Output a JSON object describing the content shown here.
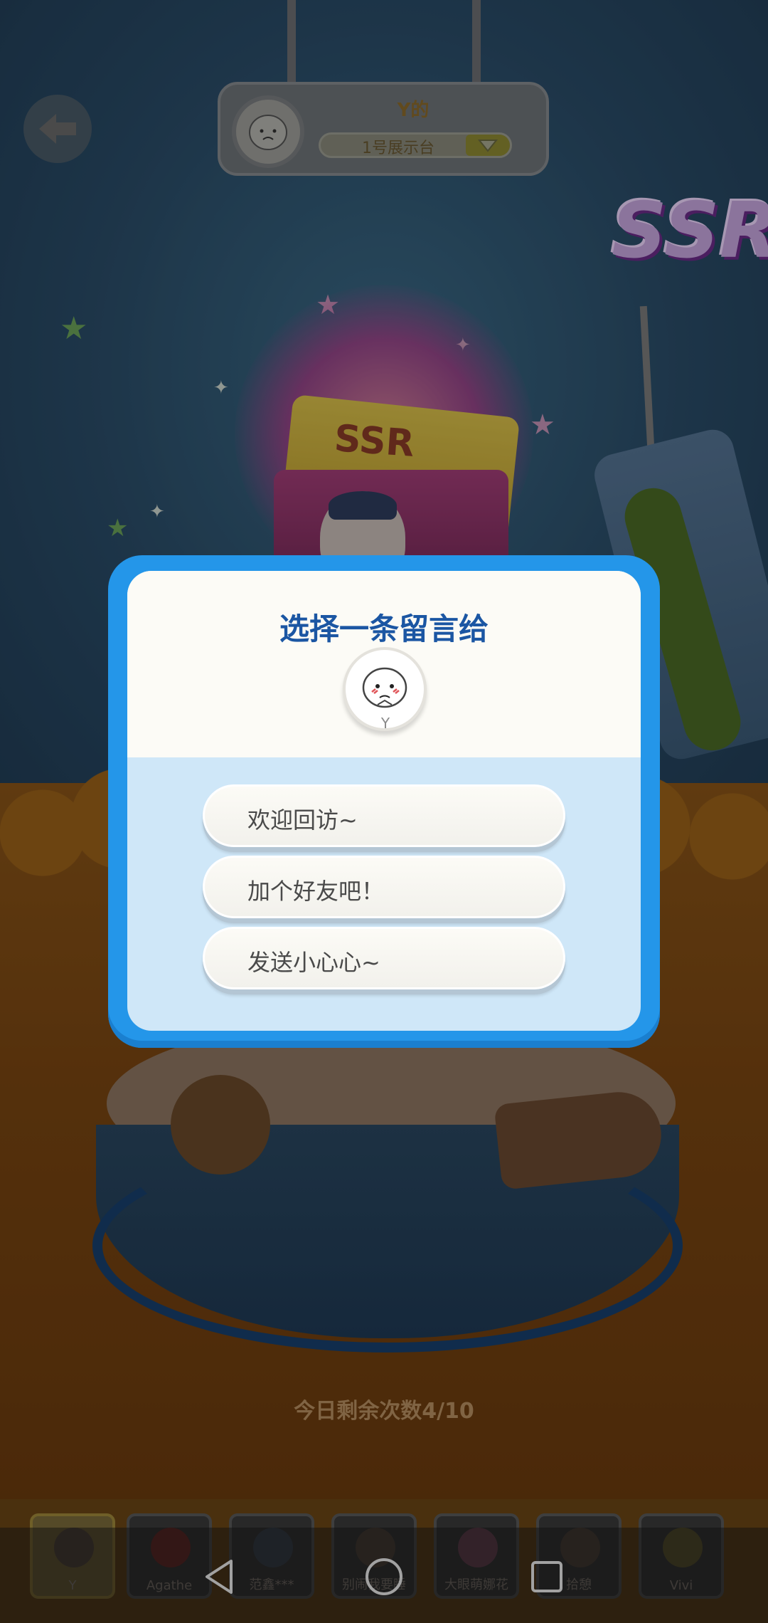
{
  "header": {
    "back_icon": "back-arrow-icon",
    "owner_name": "Y的",
    "showcase_select": "1号展示台",
    "dropdown_icon": "triangle-down-icon"
  },
  "scene": {
    "rarity_badge": "SSR",
    "ticket_label": "SSR"
  },
  "dialog": {
    "title": "选择一条留言给",
    "avatar_letter": "Y",
    "options": [
      {
        "label": "欢迎回访~"
      },
      {
        "label": "加个好友吧！"
      },
      {
        "label": "发送小心心~"
      }
    ]
  },
  "footer": {
    "remaining": "今日剩余次数4/10"
  },
  "friends": [
    {
      "label": "Y"
    },
    {
      "label": "Agathe"
    },
    {
      "label": "范鑫***"
    },
    {
      "label": "别闹我要睡"
    },
    {
      "label": "大眼萌娜花"
    },
    {
      "label": "拾憩"
    },
    {
      "label": "Vivi"
    }
  ],
  "navigation": {
    "back": "triangle-back-icon",
    "home": "circle-home-icon",
    "recents": "square-recents-icon"
  },
  "colors": {
    "dialog_frame": "#2496e9",
    "dialog_title": "#1b56a3",
    "dialog_body": "#cfe7f8",
    "dialog_head": "#fcfbf6"
  }
}
